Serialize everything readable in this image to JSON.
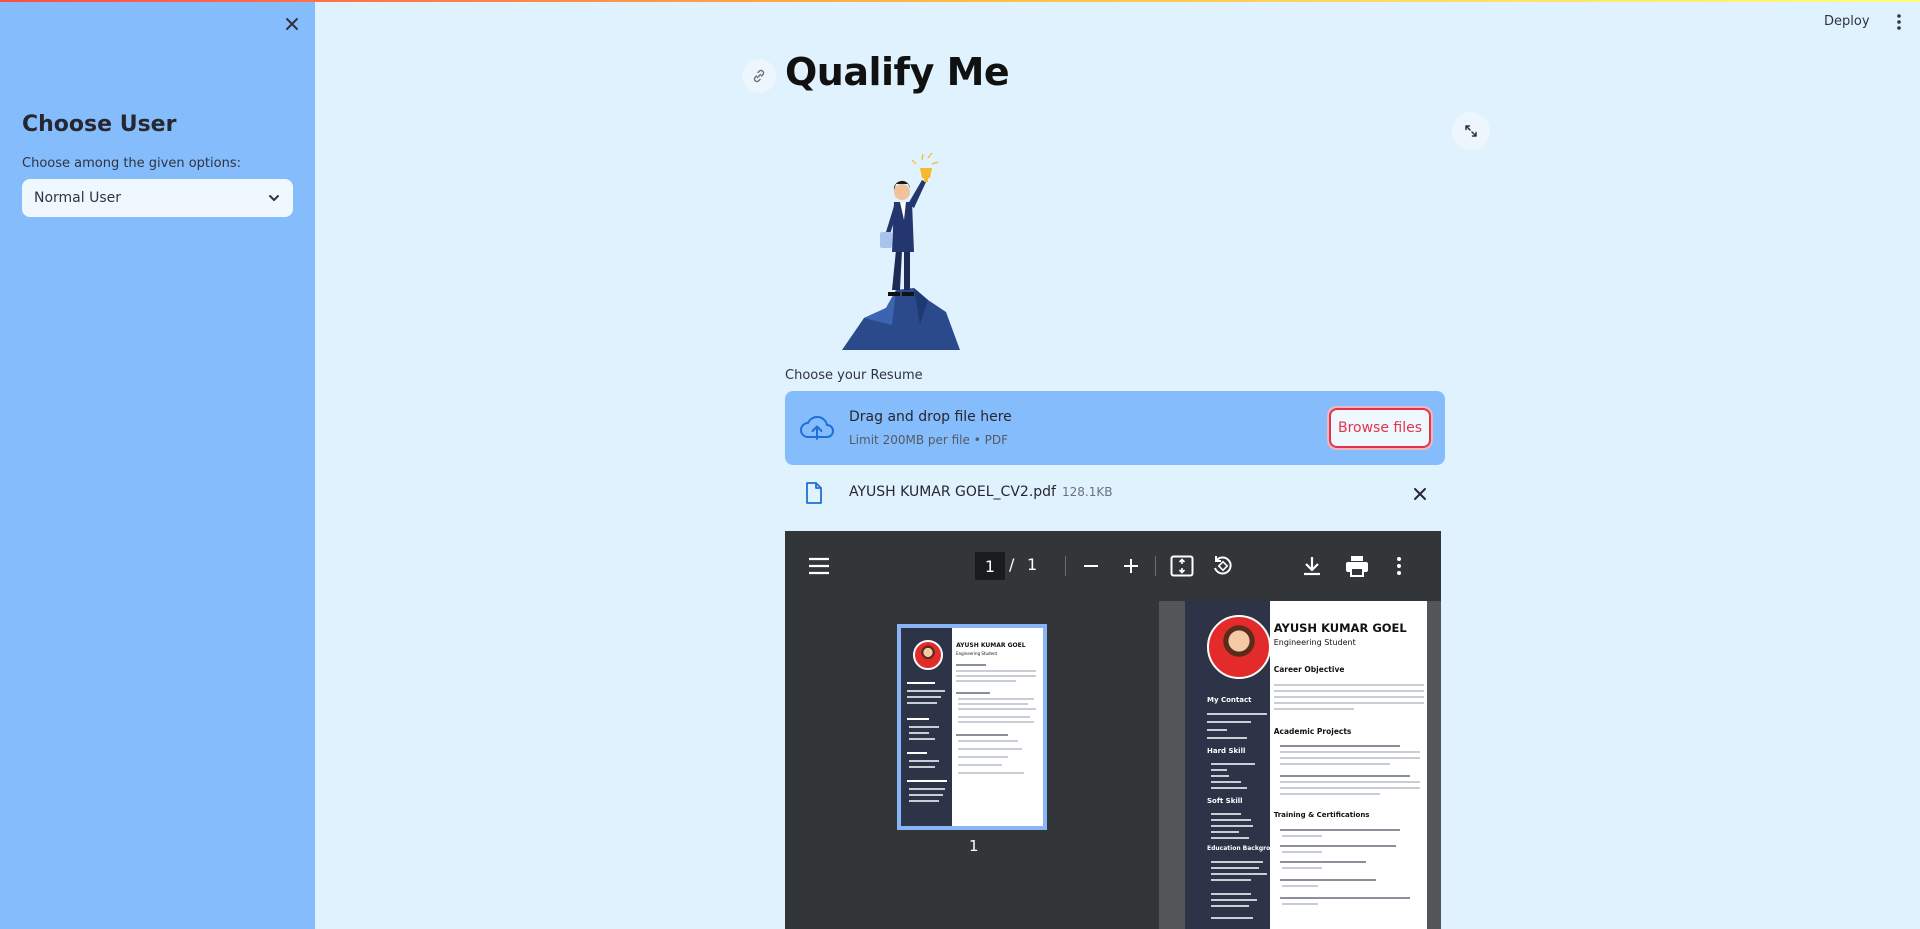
{
  "sidebar": {
    "title": "Choose User",
    "select_label": "Choose among the given options:",
    "select_value": "Normal User"
  },
  "header": {
    "deploy_label": "Deploy"
  },
  "main": {
    "title": "Qualify Me",
    "uploader": {
      "label": "Choose your Resume",
      "drop_title": "Drag and drop file here",
      "drop_sub": "Limit 200MB per file • PDF",
      "browse_label": "Browse files"
    },
    "file": {
      "name": "AYUSH KUMAR GOEL_CV2.pdf",
      "size": "128.1KB"
    }
  },
  "pdf_viewer": {
    "current_page": "1",
    "separator": "/",
    "total_pages": "1",
    "thumb_label": "1",
    "resume": {
      "name": "AYUSH KUMAR GOEL",
      "role": "Engineering Student",
      "sections_right": [
        "Career Objective",
        "Academic Projects",
        "Training & Certifications"
      ],
      "sections_left": [
        "My Contact",
        "Hard Skill",
        "Soft Skill",
        "Education Background"
      ]
    }
  },
  "colors": {
    "sidebar_bg": "#85bcfb",
    "main_bg": "#e0f2fe",
    "accent": "#e0354a",
    "pdf_toolbar": "#323639"
  }
}
